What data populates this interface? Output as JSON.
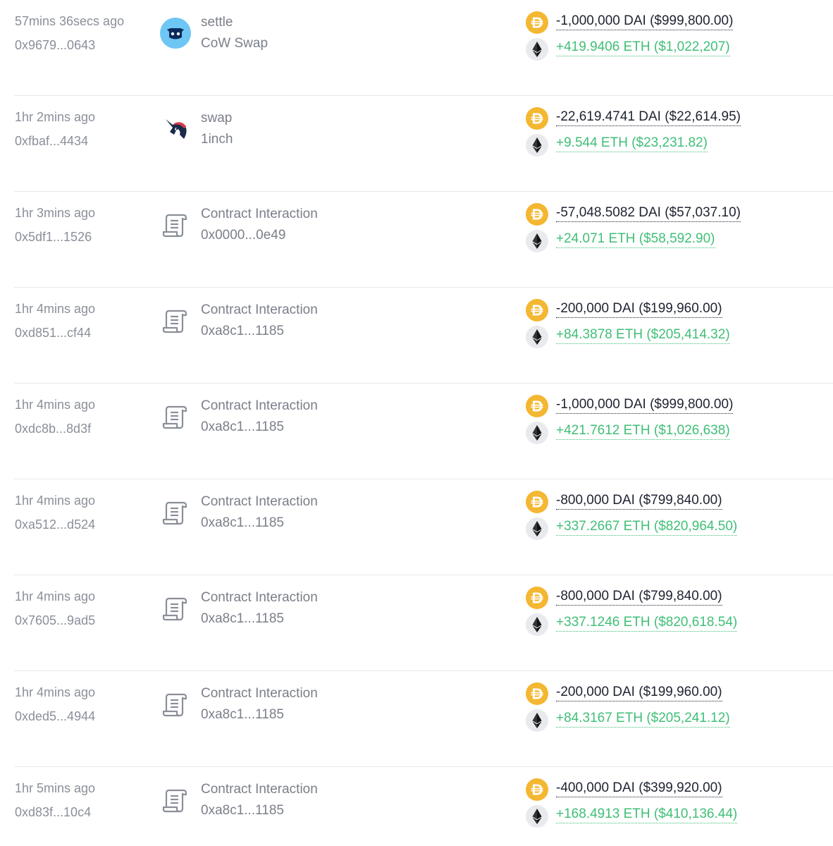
{
  "colors": {
    "muted_text": "#8a8f99",
    "negative_amount": "#1e2330",
    "positive_amount": "#3fbf76",
    "dai": "#f4b731",
    "eth_bg": "#e8eaee",
    "divider": "#e6e8ec"
  },
  "transactions": [
    {
      "time": "57mins 36secs ago",
      "hash": "0x9679...0643",
      "action": "settle",
      "app": "CoW Swap",
      "icon": "cow-swap-icon",
      "out_amount": "-1,000,000 DAI ($999,800.00)",
      "in_amount": "+419.9406 ETH ($1,022,207)"
    },
    {
      "time": "1hr 2mins ago",
      "hash": "0xfbaf...4434",
      "action": "swap",
      "app": "1inch",
      "icon": "1inch-unicorn-icon",
      "out_amount": "-22,619.4741 DAI ($22,614.95)",
      "in_amount": "+9.544 ETH ($23,231.82)"
    },
    {
      "time": "1hr 3mins ago",
      "hash": "0x5df1...1526",
      "action": "Contract Interaction",
      "app": "0x0000...0e49",
      "icon": "contract-scroll-icon",
      "out_amount": "-57,048.5082 DAI ($57,037.10)",
      "in_amount": "+24.071 ETH ($58,592.90)"
    },
    {
      "time": "1hr 4mins ago",
      "hash": "0xd851...cf44",
      "action": "Contract Interaction",
      "app": "0xa8c1...1185",
      "icon": "contract-scroll-icon",
      "out_amount": "-200,000 DAI ($199,960.00)",
      "in_amount": "+84.3878 ETH ($205,414.32)"
    },
    {
      "time": "1hr 4mins ago",
      "hash": "0xdc8b...8d3f",
      "action": "Contract Interaction",
      "app": "0xa8c1...1185",
      "icon": "contract-scroll-icon",
      "out_amount": "-1,000,000 DAI ($999,800.00)",
      "in_amount": "+421.7612 ETH ($1,026,638)"
    },
    {
      "time": "1hr 4mins ago",
      "hash": "0xa512...d524",
      "action": "Contract Interaction",
      "app": "0xa8c1...1185",
      "icon": "contract-scroll-icon",
      "out_amount": "-800,000 DAI ($799,840.00)",
      "in_amount": "+337.2667 ETH ($820,964.50)"
    },
    {
      "time": "1hr 4mins ago",
      "hash": "0x7605...9ad5",
      "action": "Contract Interaction",
      "app": "0xa8c1...1185",
      "icon": "contract-scroll-icon",
      "out_amount": "-800,000 DAI ($799,840.00)",
      "in_amount": "+337.1246 ETH ($820,618.54)"
    },
    {
      "time": "1hr 4mins ago",
      "hash": "0xded5...4944",
      "action": "Contract Interaction",
      "app": "0xa8c1...1185",
      "icon": "contract-scroll-icon",
      "out_amount": "-200,000 DAI ($199,960.00)",
      "in_amount": "+84.3167 ETH ($205,241.12)"
    },
    {
      "time": "1hr 5mins ago",
      "hash": "0xd83f...10c4",
      "action": "Contract Interaction",
      "app": "0xa8c1...1185",
      "icon": "contract-scroll-icon",
      "out_amount": "-400,000 DAI ($399,920.00)",
      "in_amount": "+168.4913 ETH ($410,136.44)"
    }
  ]
}
